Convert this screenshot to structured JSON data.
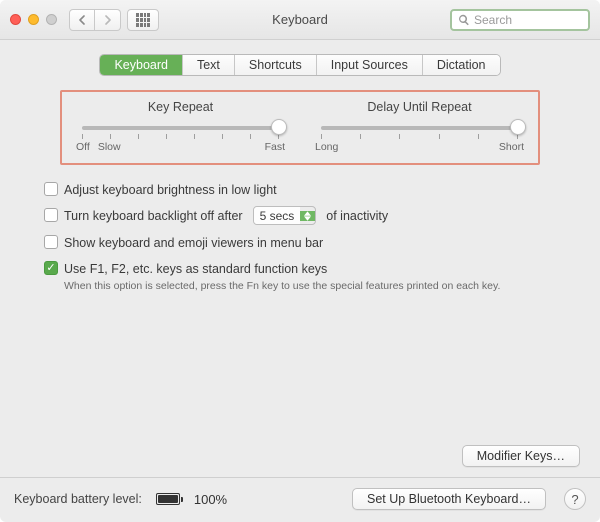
{
  "window": {
    "title": "Keyboard"
  },
  "search": {
    "placeholder": "Search"
  },
  "tabs": {
    "items": [
      "Keyboard",
      "Text",
      "Shortcuts",
      "Input Sources",
      "Dictation"
    ],
    "active_index": 0
  },
  "sliders": {
    "key_repeat": {
      "title": "Key Repeat",
      "left_label": "Off",
      "left_label2": "Slow",
      "right_label": "Fast",
      "tick_count": 8,
      "value_pct": 100
    },
    "delay_repeat": {
      "title": "Delay Until Repeat",
      "left_label": "Long",
      "right_label": "Short",
      "tick_count": 6,
      "value_pct": 100
    }
  },
  "options": {
    "brightness_low_light": {
      "checked": false,
      "label": "Adjust keyboard brightness in low light"
    },
    "backlight_off": {
      "checked": false,
      "label_before": "Turn keyboard backlight off after",
      "select_value": "5 secs",
      "label_after": "of inactivity"
    },
    "show_viewers": {
      "checked": false,
      "label": "Show keyboard and emoji viewers in menu bar"
    },
    "fn_keys": {
      "checked": true,
      "label": "Use F1, F2, etc. keys as standard function keys",
      "hint": "When this option is selected, press the Fn key to use the special features printed on each key."
    }
  },
  "buttons": {
    "modifier_keys": "Modifier Keys…",
    "bluetooth": "Set Up Bluetooth Keyboard…",
    "help": "?"
  },
  "battery": {
    "label": "Keyboard battery level:",
    "percent_text": "100%",
    "percent_value": 100
  },
  "colors": {
    "accent": "#67b057",
    "highlight_border": "#e38f7d"
  }
}
